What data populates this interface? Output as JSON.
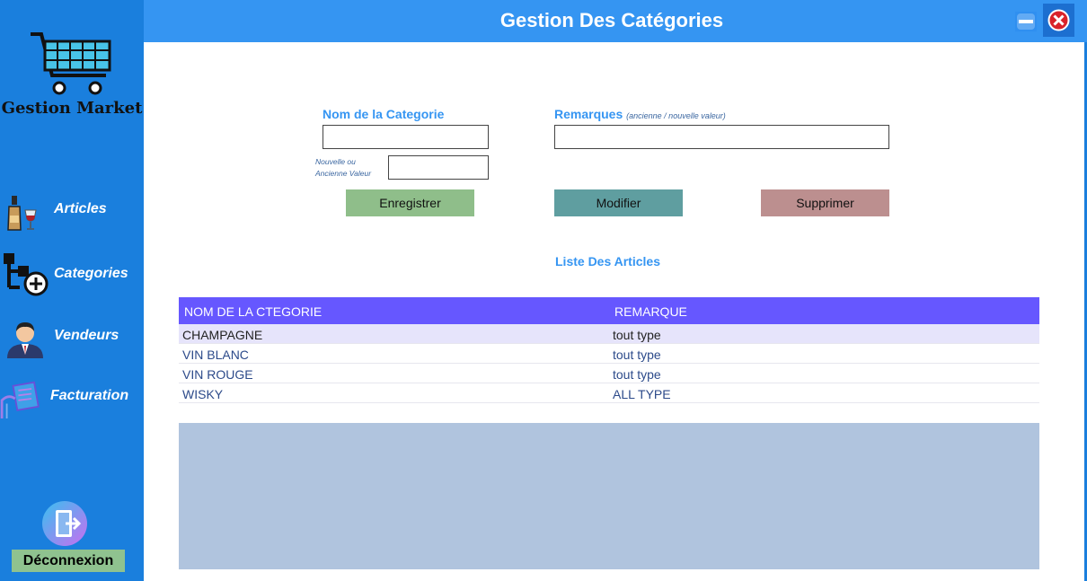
{
  "app": {
    "title": "Gestion Des Catégories",
    "brand": "Gestion Market"
  },
  "sidebar": {
    "items": [
      {
        "label": "Articles",
        "icon": "wine-bottle-icon"
      },
      {
        "label": "Categories",
        "icon": "category-tree-add-icon"
      },
      {
        "label": "Vendeurs",
        "icon": "seller-person-icon"
      },
      {
        "label": "Facturation",
        "icon": "invoice-icon"
      }
    ],
    "logout_label": "Déconnexion"
  },
  "form": {
    "name_label": "Nom de la Categorie",
    "remark_label": "Remarques",
    "remark_hint": "(ancienne / nouvelle valeur)",
    "value_hint_line1": "Nouvelle ou",
    "value_hint_line2": "Ancienne Valeur",
    "name_value": "",
    "remark_value": "",
    "old_value": ""
  },
  "actions": {
    "save": "Enregistrer",
    "edit": "Modifier",
    "delete": "Supprimer"
  },
  "colors": {
    "sidebar": "#1a7fdd",
    "header": "#3595f2",
    "grid_header": "#6657ff",
    "save": "#8fbe8a",
    "edit": "#5f9ea0",
    "delete": "#bc8f8f"
  },
  "list": {
    "title": "Liste Des Articles",
    "columns": [
      "NOM DE LA CTEGORIE",
      "REMARQUE"
    ],
    "rows": [
      {
        "name": "CHAMPAGNE",
        "remark": "tout type"
      },
      {
        "name": "VIN BLANC",
        "remark": "tout type"
      },
      {
        "name": "VIN ROUGE",
        "remark": "tout type"
      },
      {
        "name": "WISKY",
        "remark": "ALL TYPE"
      }
    ]
  }
}
